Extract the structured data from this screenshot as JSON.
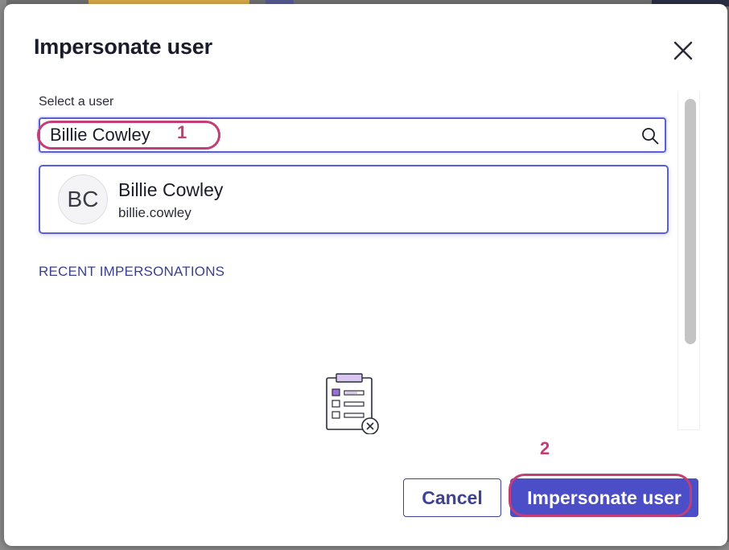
{
  "dialog": {
    "title": "Impersonate user",
    "close_icon": "close-icon"
  },
  "search": {
    "label": "Select a user",
    "value": "Billie Cowley",
    "icon": "search-icon"
  },
  "results": [
    {
      "initials": "BC",
      "name": "Billie Cowley",
      "username": "billie.cowley"
    }
  ],
  "recent": {
    "heading": "RECENT IMPERSONATIONS",
    "empty_icon": "empty-clipboard-icon"
  },
  "actions": {
    "cancel_label": "Cancel",
    "submit_label": "Impersonate user"
  },
  "annotations": {
    "step1": "1",
    "step2": "2",
    "color": "#c33d77"
  },
  "colors": {
    "accent": "#4b4ec6",
    "focus_border": "#5a5fd6",
    "heading": "#3a3f8f"
  }
}
